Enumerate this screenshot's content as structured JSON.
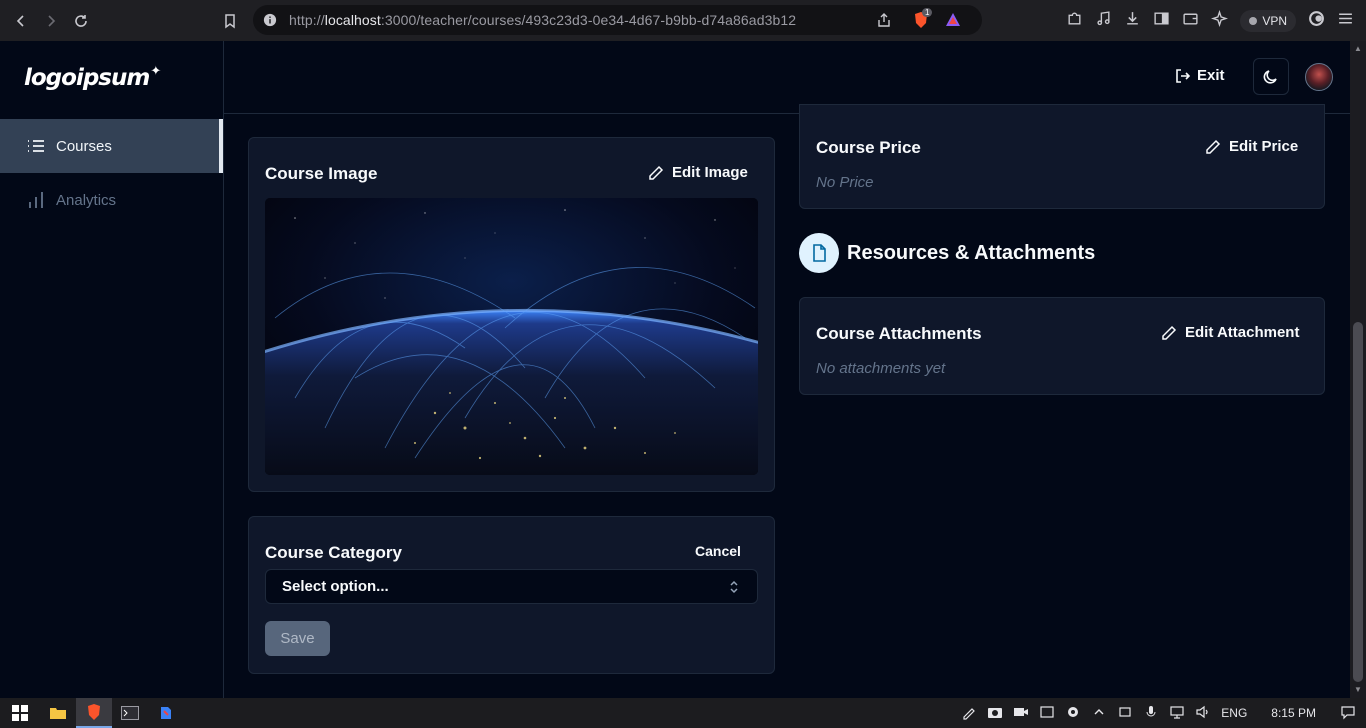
{
  "browser": {
    "url_prefix": "http://",
    "url_host": "localhost",
    "url_rest": ":3000/teacher/courses/493c23d3-0e34-4d67-b9bb-d74a86ad3b12",
    "vpn_label": "VPN",
    "brave_badge": "1"
  },
  "sidebar": {
    "logo_text": "logoipsum",
    "items": [
      {
        "label": "Courses",
        "icon": "list-icon",
        "active": true
      },
      {
        "label": "Analytics",
        "icon": "bar-chart-icon",
        "active": false
      }
    ]
  },
  "header": {
    "exit_label": "Exit",
    "theme_icon": "moon-icon"
  },
  "course_image": {
    "title": "Course Image",
    "edit_label": "Edit Image"
  },
  "course_category": {
    "title": "Course Category",
    "cancel_label": "Cancel",
    "select_placeholder": "Select option...",
    "save_label": "Save"
  },
  "course_price": {
    "title": "Course Price",
    "edit_label": "Edit Price",
    "value_text": "No Price"
  },
  "resources": {
    "section_title": "Resources & Attachments",
    "icon": "file-icon"
  },
  "course_attachments": {
    "title": "Course Attachments",
    "edit_label": "Edit Attachment",
    "empty_text": "No attachments yet"
  },
  "taskbar": {
    "lang": "ENG",
    "time": "8:15 PM"
  },
  "colors": {
    "background": "#020817",
    "card": "#0f172a",
    "border": "#1e293b",
    "muted": "#64748b",
    "accent_icon_bg": "#e0f2fe"
  }
}
